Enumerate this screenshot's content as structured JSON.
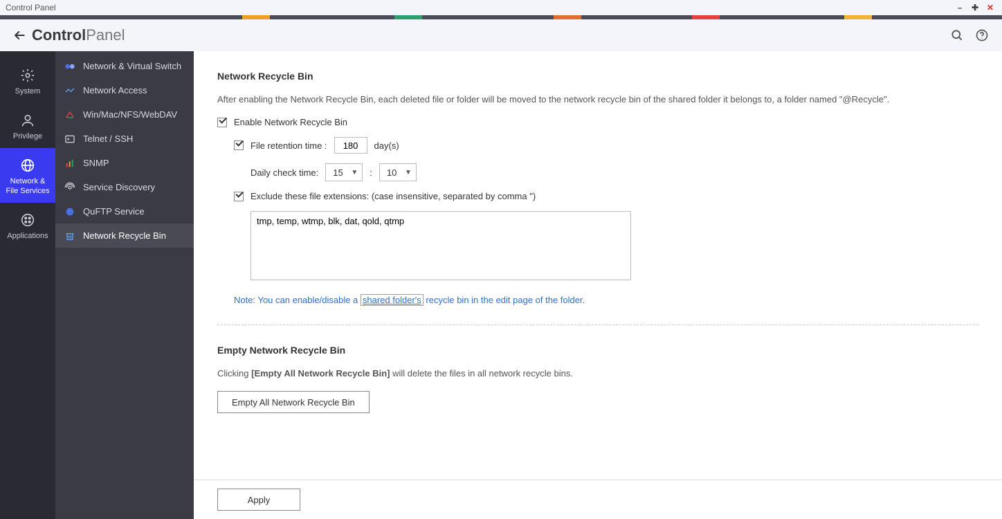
{
  "window": {
    "title": "Control Panel"
  },
  "header": {
    "title_bold": "Control",
    "title_light": "Panel"
  },
  "rail": {
    "items": [
      {
        "label": "System"
      },
      {
        "label": "Privilege"
      },
      {
        "label": "Network &\nFile Services"
      },
      {
        "label": "Applications"
      }
    ],
    "active_index": 2
  },
  "sidebar": {
    "items": [
      {
        "label": "Network & Virtual Switch"
      },
      {
        "label": "Network Access"
      },
      {
        "label": "Win/Mac/NFS/WebDAV"
      },
      {
        "label": "Telnet / SSH"
      },
      {
        "label": "SNMP"
      },
      {
        "label": "Service Discovery"
      },
      {
        "label": "QuFTP Service"
      },
      {
        "label": "Network Recycle Bin"
      }
    ],
    "active_index": 7
  },
  "main": {
    "section1": {
      "heading": "Network Recycle Bin",
      "description": "After enabling the Network Recycle Bin, each deleted file or folder will be moved to the network recycle bin of the shared folder it belongs to, a folder named \"@Recycle\".",
      "enable_label": "Enable Network Recycle Bin",
      "enable_checked": true,
      "retention": {
        "label": "File retention time :",
        "checked": true,
        "value": "180",
        "unit": "day(s)"
      },
      "dailycheck": {
        "label": "Daily check time:",
        "hour": "15",
        "minute": "10"
      },
      "exclude": {
        "label": "Exclude these file extensions: (case insensitive, separated by comma \")",
        "checked": true,
        "value": "tmp, temp, wtmp, blk, dat, qold, qtmp"
      },
      "note": {
        "prefix": "Note:",
        "t1": "You can enable/disable a",
        "link": "shared folder's",
        "t2": "recycle bin in the edit page of the folder."
      }
    },
    "section2": {
      "heading": "Empty Network Recycle Bin",
      "desc_pre": "Clicking ",
      "desc_bold": "[Empty All Network Recycle Bin]",
      "desc_post": " will delete the files in all network recycle bins.",
      "button": "Empty All Network Recycle Bin"
    },
    "footer": {
      "apply": "Apply"
    }
  },
  "accent_colors": [
    "#f0a020",
    "#2aa06a",
    "#2aa06a",
    "#e07030",
    "#e84040",
    "#f0b430"
  ]
}
